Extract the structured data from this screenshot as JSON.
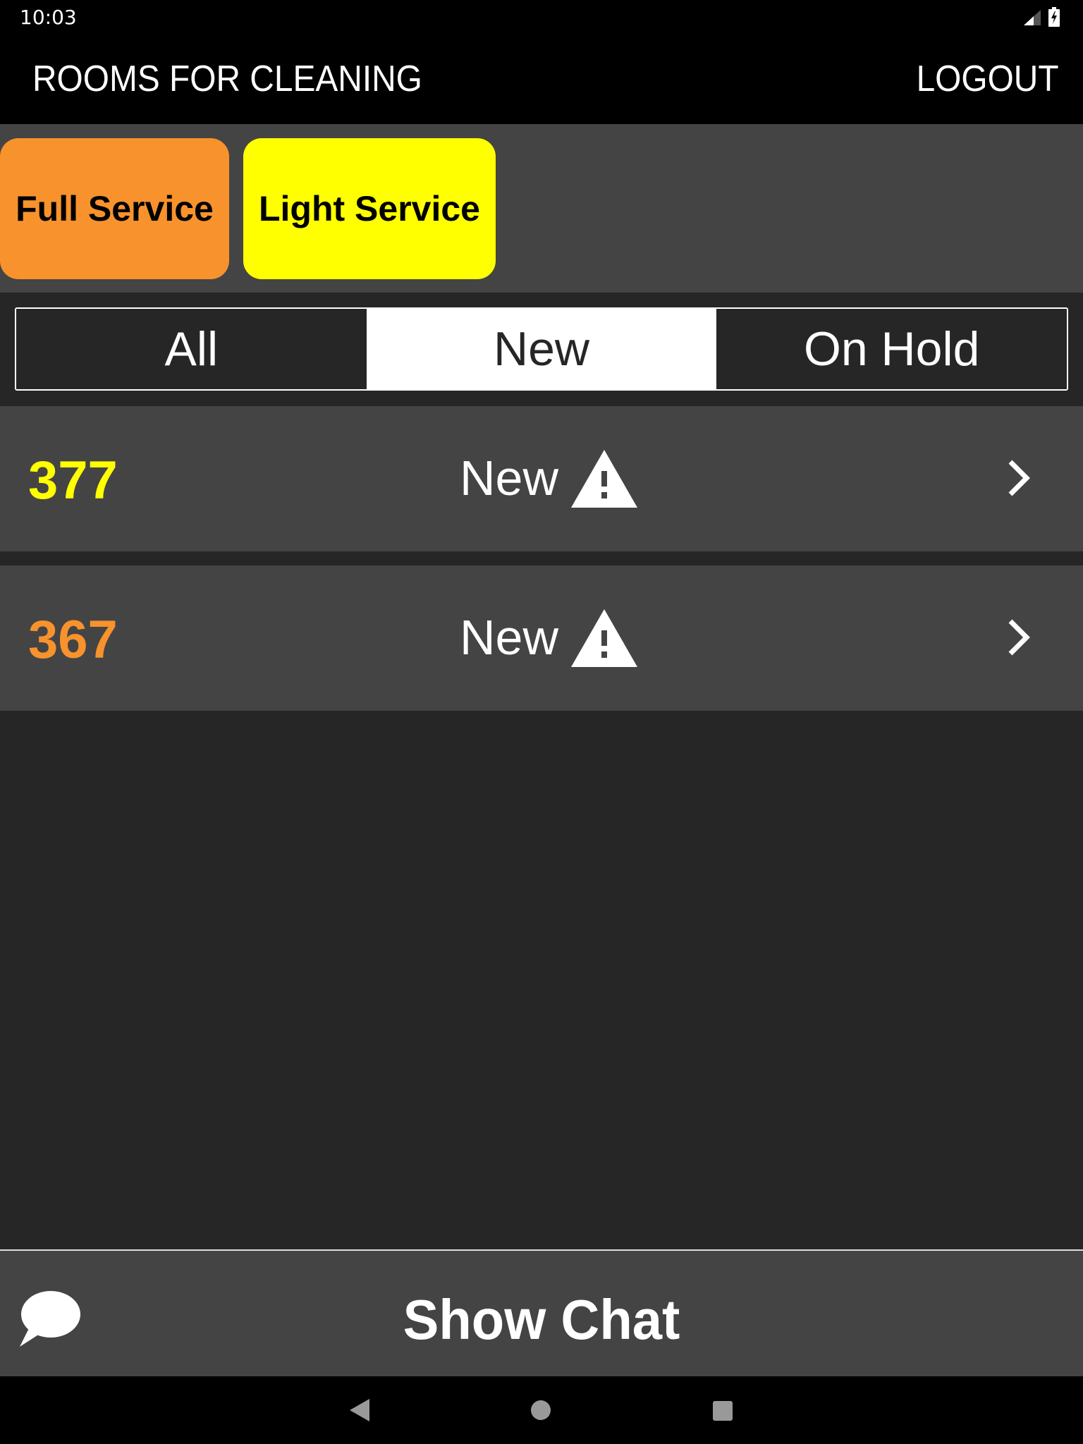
{
  "status_bar": {
    "time": "10:03",
    "icons": [
      "signal-icon",
      "battery-charging-icon"
    ]
  },
  "app_bar": {
    "title": "ROOMS FOR CLEANING",
    "logout_label": "LOGOUT"
  },
  "service_types": [
    {
      "label": "Full Service",
      "color": "#f7922d"
    },
    {
      "label": "Light Service",
      "color": "#ffff00"
    }
  ],
  "filter_tabs": [
    {
      "label": "All",
      "selected": false
    },
    {
      "label": "New",
      "selected": true
    },
    {
      "label": "On Hold",
      "selected": false
    }
  ],
  "rooms": [
    {
      "number": "377",
      "status": "New",
      "color": "#ffff00",
      "status_icon": "warning-icon",
      "action_icon": "chevron-right-icon"
    },
    {
      "number": "367",
      "status": "New",
      "color": "#f7922d",
      "status_icon": "warning-icon",
      "action_icon": "chevron-right-icon"
    }
  ],
  "chat_bar": {
    "label": "Show Chat",
    "icon": "chat-bubble-icon"
  },
  "nav_bar": {
    "icons": [
      "back-icon",
      "home-icon",
      "recents-icon"
    ]
  }
}
